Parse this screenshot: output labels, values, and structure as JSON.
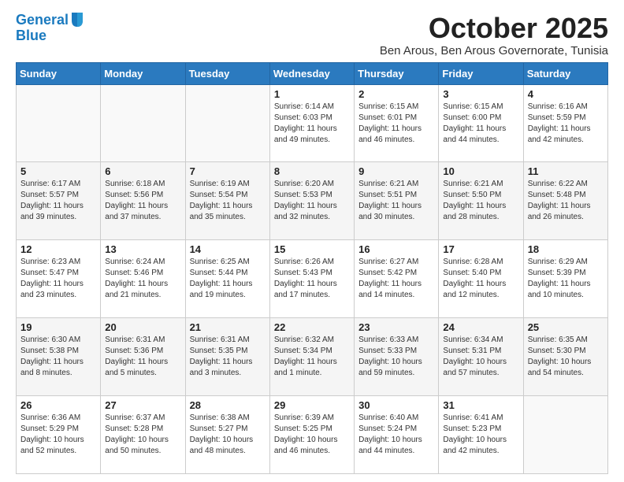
{
  "header": {
    "logo_line1": "General",
    "logo_line2": "Blue",
    "month": "October 2025",
    "location": "Ben Arous, Ben Arous Governorate, Tunisia"
  },
  "days_of_week": [
    "Sunday",
    "Monday",
    "Tuesday",
    "Wednesday",
    "Thursday",
    "Friday",
    "Saturday"
  ],
  "weeks": [
    [
      {
        "day": "",
        "info": ""
      },
      {
        "day": "",
        "info": ""
      },
      {
        "day": "",
        "info": ""
      },
      {
        "day": "1",
        "info": "Sunrise: 6:14 AM\nSunset: 6:03 PM\nDaylight: 11 hours\nand 49 minutes."
      },
      {
        "day": "2",
        "info": "Sunrise: 6:15 AM\nSunset: 6:01 PM\nDaylight: 11 hours\nand 46 minutes."
      },
      {
        "day": "3",
        "info": "Sunrise: 6:15 AM\nSunset: 6:00 PM\nDaylight: 11 hours\nand 44 minutes."
      },
      {
        "day": "4",
        "info": "Sunrise: 6:16 AM\nSunset: 5:59 PM\nDaylight: 11 hours\nand 42 minutes."
      }
    ],
    [
      {
        "day": "5",
        "info": "Sunrise: 6:17 AM\nSunset: 5:57 PM\nDaylight: 11 hours\nand 39 minutes."
      },
      {
        "day": "6",
        "info": "Sunrise: 6:18 AM\nSunset: 5:56 PM\nDaylight: 11 hours\nand 37 minutes."
      },
      {
        "day": "7",
        "info": "Sunrise: 6:19 AM\nSunset: 5:54 PM\nDaylight: 11 hours\nand 35 minutes."
      },
      {
        "day": "8",
        "info": "Sunrise: 6:20 AM\nSunset: 5:53 PM\nDaylight: 11 hours\nand 32 minutes."
      },
      {
        "day": "9",
        "info": "Sunrise: 6:21 AM\nSunset: 5:51 PM\nDaylight: 11 hours\nand 30 minutes."
      },
      {
        "day": "10",
        "info": "Sunrise: 6:21 AM\nSunset: 5:50 PM\nDaylight: 11 hours\nand 28 minutes."
      },
      {
        "day": "11",
        "info": "Sunrise: 6:22 AM\nSunset: 5:48 PM\nDaylight: 11 hours\nand 26 minutes."
      }
    ],
    [
      {
        "day": "12",
        "info": "Sunrise: 6:23 AM\nSunset: 5:47 PM\nDaylight: 11 hours\nand 23 minutes."
      },
      {
        "day": "13",
        "info": "Sunrise: 6:24 AM\nSunset: 5:46 PM\nDaylight: 11 hours\nand 21 minutes."
      },
      {
        "day": "14",
        "info": "Sunrise: 6:25 AM\nSunset: 5:44 PM\nDaylight: 11 hours\nand 19 minutes."
      },
      {
        "day": "15",
        "info": "Sunrise: 6:26 AM\nSunset: 5:43 PM\nDaylight: 11 hours\nand 17 minutes."
      },
      {
        "day": "16",
        "info": "Sunrise: 6:27 AM\nSunset: 5:42 PM\nDaylight: 11 hours\nand 14 minutes."
      },
      {
        "day": "17",
        "info": "Sunrise: 6:28 AM\nSunset: 5:40 PM\nDaylight: 11 hours\nand 12 minutes."
      },
      {
        "day": "18",
        "info": "Sunrise: 6:29 AM\nSunset: 5:39 PM\nDaylight: 11 hours\nand 10 minutes."
      }
    ],
    [
      {
        "day": "19",
        "info": "Sunrise: 6:30 AM\nSunset: 5:38 PM\nDaylight: 11 hours\nand 8 minutes."
      },
      {
        "day": "20",
        "info": "Sunrise: 6:31 AM\nSunset: 5:36 PM\nDaylight: 11 hours\nand 5 minutes."
      },
      {
        "day": "21",
        "info": "Sunrise: 6:31 AM\nSunset: 5:35 PM\nDaylight: 11 hours\nand 3 minutes."
      },
      {
        "day": "22",
        "info": "Sunrise: 6:32 AM\nSunset: 5:34 PM\nDaylight: 11 hours\nand 1 minute."
      },
      {
        "day": "23",
        "info": "Sunrise: 6:33 AM\nSunset: 5:33 PM\nDaylight: 10 hours\nand 59 minutes."
      },
      {
        "day": "24",
        "info": "Sunrise: 6:34 AM\nSunset: 5:31 PM\nDaylight: 10 hours\nand 57 minutes."
      },
      {
        "day": "25",
        "info": "Sunrise: 6:35 AM\nSunset: 5:30 PM\nDaylight: 10 hours\nand 54 minutes."
      }
    ],
    [
      {
        "day": "26",
        "info": "Sunrise: 6:36 AM\nSunset: 5:29 PM\nDaylight: 10 hours\nand 52 minutes."
      },
      {
        "day": "27",
        "info": "Sunrise: 6:37 AM\nSunset: 5:28 PM\nDaylight: 10 hours\nand 50 minutes."
      },
      {
        "day": "28",
        "info": "Sunrise: 6:38 AM\nSunset: 5:27 PM\nDaylight: 10 hours\nand 48 minutes."
      },
      {
        "day": "29",
        "info": "Sunrise: 6:39 AM\nSunset: 5:25 PM\nDaylight: 10 hours\nand 46 minutes."
      },
      {
        "day": "30",
        "info": "Sunrise: 6:40 AM\nSunset: 5:24 PM\nDaylight: 10 hours\nand 44 minutes."
      },
      {
        "day": "31",
        "info": "Sunrise: 6:41 AM\nSunset: 5:23 PM\nDaylight: 10 hours\nand 42 minutes."
      },
      {
        "day": "",
        "info": ""
      }
    ]
  ]
}
